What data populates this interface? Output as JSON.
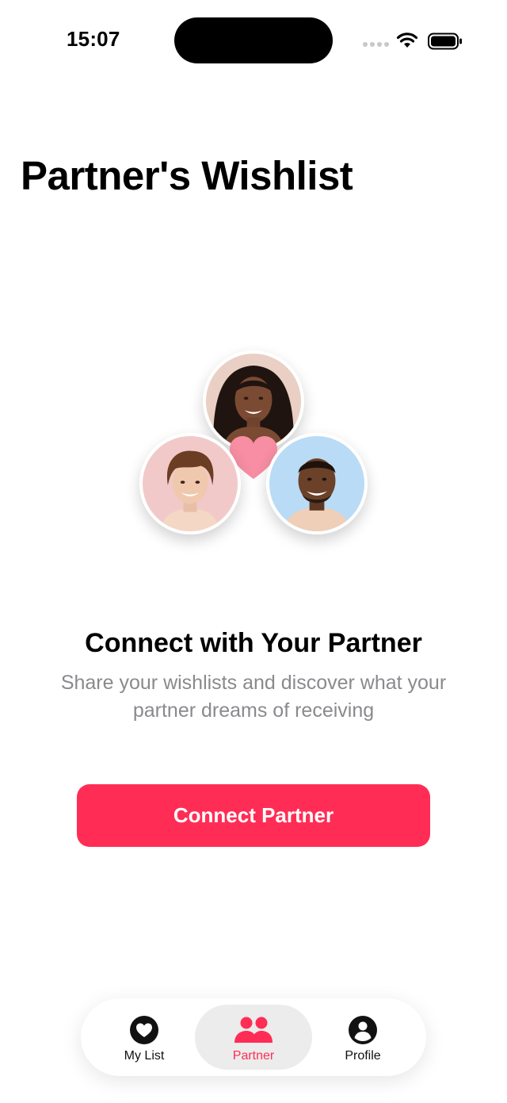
{
  "status_bar": {
    "time": "15:07"
  },
  "page": {
    "title": "Partner's Wishlist"
  },
  "empty_state": {
    "headline": "Connect with Your Partner",
    "subtitle": "Share your wishlists and discover what your partner dreams of receiving",
    "button_label": "Connect Partner"
  },
  "tab_bar": {
    "tabs": [
      {
        "label": "My List",
        "icon": "heart-circle-icon",
        "active": false
      },
      {
        "label": "Partner",
        "icon": "people-icon",
        "active": true
      },
      {
        "label": "Profile",
        "icon": "person-circle-icon",
        "active": false
      }
    ]
  },
  "colors": {
    "accent": "#ff2d55",
    "heart": "#f78ea3",
    "subtitle_text": "#8a8a8e",
    "tab_active_bg": "#ececec"
  }
}
